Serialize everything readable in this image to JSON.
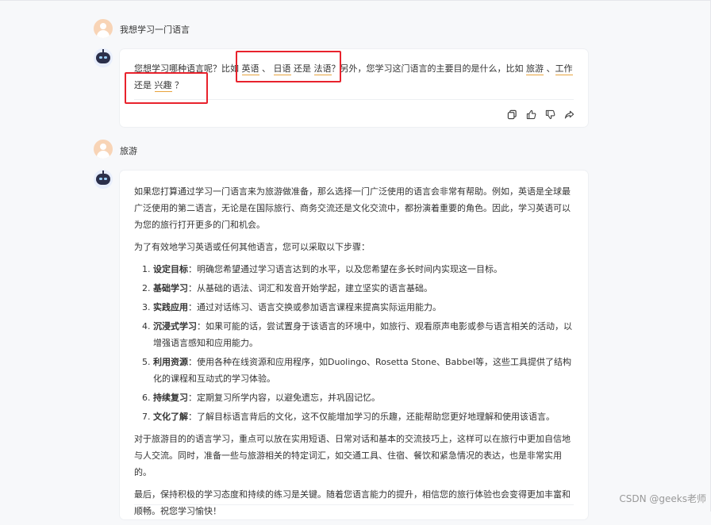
{
  "messages": {
    "user1": "我想学习一门语言",
    "bot1": {
      "parts": [
        "您想学习哪种语言呢？比如 ",
        "英语",
        " 、 ",
        "日语",
        " 还是 ",
        "法语",
        "？另外，您学习这门语言的主要目的是什么，比如 ",
        "旅游",
        " 、",
        "工作",
        " 还是 ",
        "兴趣",
        " ？"
      ]
    },
    "user2": "旅游",
    "bot2": {
      "intro": "如果您打算通过学习一门语言来为旅游做准备，那么选择一门广泛使用的语言会非常有帮助。例如，英语是全球最广泛使用的第二语言，无论是在国际旅行、商务交流还是文化交流中，都扮演着重要的角色。因此，学习英语可以为您的旅行打开更多的门和机会。",
      "steps_intro": "为了有效地学习英语或任何其他语言，您可以采取以下步骤：",
      "steps": [
        {
          "title": "设定目标",
          "text": "：明确您希望通过学习语言达到的水平，以及您希望在多长时间内实现这一目标。"
        },
        {
          "title": "基础学习",
          "text": "：从基础的语法、词汇和发音开始学起，建立坚实的语言基础。"
        },
        {
          "title": "实践应用",
          "text": "：通过对话练习、语言交换或参加语言课程来提高实际运用能力。"
        },
        {
          "title": "沉浸式学习",
          "text": "：如果可能的话，尝试置身于该语言的环境中，如旅行、观看原声电影或参与语言相关的活动，以增强语言感知和应用能力。"
        },
        {
          "title": "利用资源",
          "text": "：使用各种在线资源和应用程序，如Duolingo、Rosetta Stone、Babbel等，这些工具提供了结构化的课程和互动式的学习体验。"
        },
        {
          "title": "持续复习",
          "text": "：定期复习所学内容，以避免遗忘，并巩固记忆。"
        },
        {
          "title": "文化了解",
          "text": "：了解目标语言背后的文化，这不仅能增加学习的乐趣，还能帮助您更好地理解和使用该语言。"
        }
      ],
      "para2": "对于旅游目的的语言学习，重点可以放在实用短语、日常对话和基本的交流技巧上，这样可以在旅行中更加自信地与人交流。同时，准备一些与旅游相关的特定词汇，如交通工具、住宿、餐饮和紧急情况的表达，也是非常实用的。",
      "para3": "最后，保持积极的学习态度和持续的练习是关键。随着您语言能力的提升，相信您的旅行体验也会变得更加丰富和顺畅。祝您学习愉快！"
    }
  },
  "actions": [
    "copy-icon",
    "thumbs-up-icon",
    "thumbs-down-icon",
    "share-icon"
  ],
  "watermark": "CSDN @geeks老师",
  "colors": {
    "highlight_box": "#e8222c",
    "option_underline": "#e8a33d"
  }
}
